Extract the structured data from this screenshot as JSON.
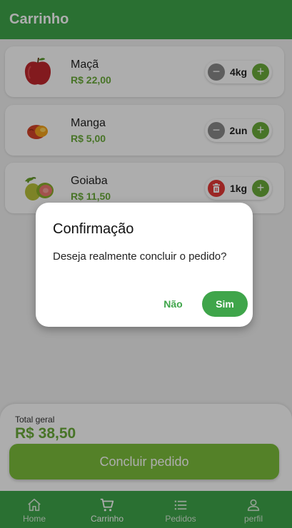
{
  "header": {
    "title": "Carrinho"
  },
  "items": [
    {
      "name": "Maçã",
      "price": "R$ 22,00",
      "quantity": "4kg",
      "left_action": "minus-icon",
      "image": "apple-image"
    },
    {
      "name": "Manga",
      "price": "R$ 5,00",
      "quantity": "2un",
      "left_action": "minus-icon",
      "image": "mango-image"
    },
    {
      "name": "Goiaba",
      "price": "R$ 11,50",
      "quantity": "1kg",
      "left_action": "trash-icon",
      "image": "guava-image"
    }
  ],
  "summary": {
    "total_label": "Total geral",
    "total_value": "R$ 38,50",
    "conclude_label": "Concluir pedido"
  },
  "nav": [
    {
      "label": "Home",
      "icon": "home-icon",
      "active": false
    },
    {
      "label": "Carrinho",
      "icon": "cart-icon",
      "active": true
    },
    {
      "label": "Pedidos",
      "icon": "list-icon",
      "active": false
    },
    {
      "label": "perfil",
      "icon": "user-icon",
      "active": false
    }
  ],
  "dialog": {
    "title": "Confirmação",
    "message": "Deseja realmente concluir o pedido?",
    "cancel_label": "Não",
    "confirm_label": "Sim"
  },
  "colors": {
    "primary": "#3fa54a",
    "accent": "#6aac3a",
    "danger": "#e53935"
  }
}
